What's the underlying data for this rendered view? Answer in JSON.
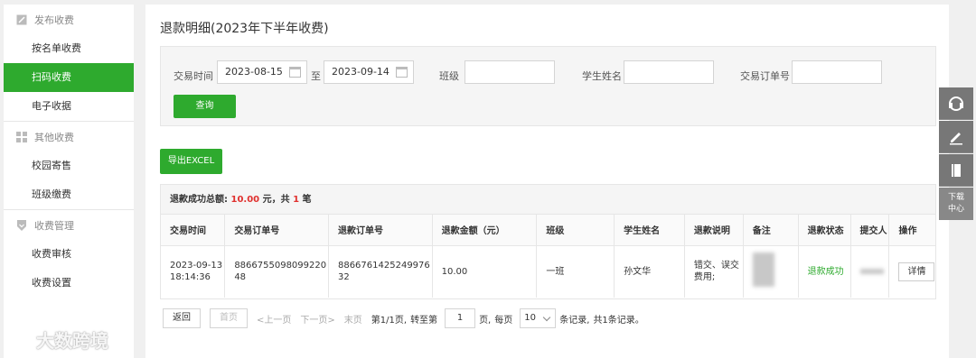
{
  "sidebar": {
    "groups": [
      {
        "label": "发布收费",
        "items": [
          "按名单收费",
          "扫码收费",
          "电子收据"
        ]
      },
      {
        "label": "其他收费",
        "items": [
          "校园寄售",
          "班级缴费"
        ]
      },
      {
        "label": "收费管理",
        "items": [
          "收费审核",
          "收费设置"
        ]
      }
    ],
    "active_item": "扫码收费"
  },
  "page_title": "退款明细(2023年下半年收费)",
  "filters": {
    "time_label": "交易时间",
    "start_date": "2023-08-15",
    "to_label": "至",
    "end_date": "2023-09-14",
    "class_label": "班级",
    "class_value": "",
    "student_label": "学生姓名",
    "student_value": "",
    "order_label": "交易订单号",
    "order_value": "",
    "query_button": "查询"
  },
  "export_button": "导出EXCEL",
  "summary": {
    "prefix": "退款成功总额:",
    "amount": "10.00",
    "unit": "元，共",
    "count": "1",
    "suffix": "笔"
  },
  "table": {
    "headers": [
      "交易时间",
      "交易订单号",
      "退款订单号",
      "退款金额（元）",
      "班级",
      "学生姓名",
      "退款说明",
      "备注",
      "退款状态",
      "提交人",
      "操作"
    ],
    "rows": [
      {
        "time": "2023-09-13 18:14:36",
        "trade_no": "886675509809922048",
        "refund_no": "886676142524997632",
        "amount": "10.00",
        "class": "一班",
        "student": "孙文华",
        "reason": "错交、误交费用;",
        "remark": "",
        "status": "退款成功",
        "submitter": "",
        "action": "详情"
      }
    ]
  },
  "pager": {
    "back": "返回",
    "first": "首页",
    "prev": "<上一页",
    "next": "下一页>",
    "last": "末页",
    "page_info": "第1/1页,",
    "goto_label": "转至第",
    "goto_value": "1",
    "page_suffix": "页,",
    "per_page_label": "每页",
    "per_page_value": "10",
    "records_suffix": "条记录,",
    "total": "共1条记录。"
  },
  "right_toolbar": {
    "download_label_1": "下载",
    "download_label_2": "中心"
  },
  "watermark": "大数跨境",
  "colors": {
    "accent": "#2eaa2e",
    "highlight": "#e0312f"
  }
}
